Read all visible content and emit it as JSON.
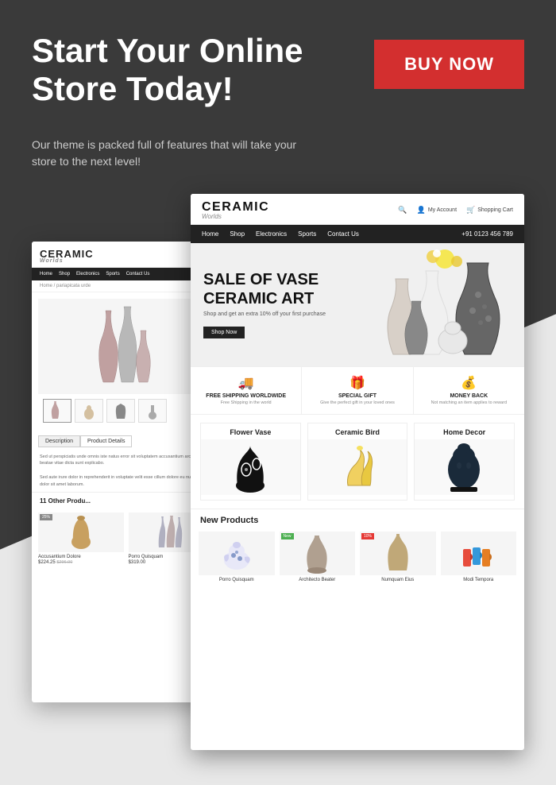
{
  "page": {
    "headline": "Start Your Online Store Today!",
    "sub_text": "Our theme is packed full of features that will take your store to the next level!",
    "buy_now_label": "BUY NOW"
  },
  "back_screenshot": {
    "brand": "CERAMIC",
    "brand_sub": "Worlds",
    "nav_items": [
      "Home",
      "Shop",
      "Electronics",
      "Sports",
      "Contact Us"
    ],
    "breadcrumb": "Home / pariapicata urde",
    "tabs": [
      "Description",
      "Product Details"
    ],
    "desc_text": "Sed ut perspiciatis unde omnis iste natus error sit voluptatem accusantium architecto beatae vitae dicta sunt explicabo.",
    "desc_text2": "Sed aute irure dolor in reprehenderit in voluptate velit esse cillum dolore eu nulla atem dolor sit amet laborum.",
    "other_prods_title": "11 Other Produ...",
    "products": [
      {
        "name": "Accusantium Dolore",
        "price": "$224.25",
        "old_price": "$296.00",
        "badge": "25%"
      },
      {
        "name": "Porro Quisquam",
        "price": "$319.00",
        "badge": ""
      }
    ]
  },
  "front_screenshot": {
    "brand": "CERAMIC",
    "brand_sub": "Worlds",
    "nav_items": [
      "Home",
      "Shop",
      "Electronics",
      "Sports",
      "Contact Us"
    ],
    "phone": "+91 0123 456 789",
    "hero": {
      "title_line1": "SALE OF VASE",
      "title_line2": "CERAMIC ART",
      "sub": "Shop and get an extra 10% off your first purchase",
      "btn": "Shop Now"
    },
    "features": [
      {
        "icon": "🚚",
        "title": "FREE SHIPPING WORLDWIDE",
        "desc": "Free Shipping in the world"
      },
      {
        "icon": "🎁",
        "title": "SPECIAL GIFT",
        "desc": "Give the perfect gift in your loved ones"
      },
      {
        "icon": "💰",
        "title": "MONEY BACK",
        "desc": "Not matching an item applies to reward"
      }
    ],
    "categories": [
      {
        "title": "Flower Vase"
      },
      {
        "title": "Ceramic Bird"
      },
      {
        "title": "Home Decor"
      }
    ],
    "new_products_title": "New Products",
    "products": [
      {
        "name": "Porro Quisquam",
        "badge": "",
        "badge_type": ""
      },
      {
        "name": "Architecto Beater",
        "badge": "New",
        "badge_type": "new-badge"
      },
      {
        "name": "Numquam Eius",
        "badge": "10%",
        "badge_type": "sale-badge"
      },
      {
        "name": "Modi Tempora",
        "badge": "",
        "badge_type": ""
      }
    ]
  },
  "colors": {
    "bg_dark": "#3a3a3a",
    "bg_light": "#e8e8e8",
    "accent": "#d32f2f",
    "brand_dark": "#222222"
  }
}
